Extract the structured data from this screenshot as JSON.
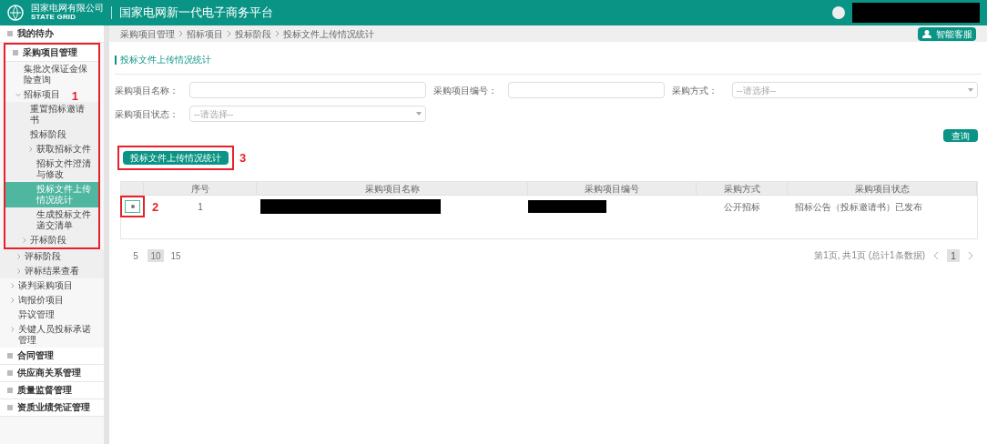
{
  "header": {
    "logo_cn": "国家电网有限公司",
    "logo_en": "STATE GRID",
    "title": "国家电网新一代电子商务平台",
    "user_redacted": true
  },
  "sidebar": {
    "items": [
      {
        "label": "我的待办",
        "kind": "section"
      },
      {
        "label": "采购项目管理",
        "kind": "section",
        "children": [
          {
            "label": "集批次保证金保险查询",
            "selected": false
          },
          {
            "label": "招标项目",
            "selected": false,
            "expanded": true,
            "children": [
              {
                "label": "重置招标邀请书",
                "selected": false
              },
              {
                "label": "投标阶段",
                "selected": false,
                "children": [
                  {
                    "label": "获取招标文件",
                    "selected": false,
                    "expanded": false
                  },
                  {
                    "label": "招标文件澄清与修改",
                    "selected": false
                  },
                  {
                    "label": "投标文件上传情况统计",
                    "selected": true
                  },
                  {
                    "label": "生成投标文件递交清单",
                    "selected": false
                  }
                ]
              },
              {
                "label": "开标阶段",
                "selected": false,
                "expanded": false
              },
              {
                "label": "评标阶段",
                "selected": false,
                "expanded": false
              },
              {
                "label": "评标结果查看",
                "selected": false,
                "expanded": false
              }
            ]
          },
          {
            "label": "谈判采购项目",
            "selected": false,
            "expanded": false
          },
          {
            "label": "询报价项目",
            "selected": false,
            "expanded": false
          },
          {
            "label": "异议管理",
            "selected": false
          },
          {
            "label": "关键人员投标承诺管理",
            "selected": false,
            "expanded": false
          }
        ]
      },
      {
        "label": "合同管理",
        "kind": "section"
      },
      {
        "label": "供应商关系管理",
        "kind": "section"
      },
      {
        "label": "质量监督管理",
        "kind": "section"
      },
      {
        "label": "资质业绩凭证管理",
        "kind": "section"
      }
    ]
  },
  "breadcrumb": [
    "采购项目管理",
    "招标项目",
    "投标阶段",
    "投标文件上传情况统计"
  ],
  "help_button": "智能客服",
  "panel_title": "投标文件上传情况统计",
  "filters": [
    {
      "label": "采购项目名称：",
      "kind": "text"
    },
    {
      "label": "采购项目编号：",
      "kind": "text"
    },
    {
      "label": "采购方式：",
      "kind": "select",
      "placeholder": "--请选择--"
    },
    {
      "label": "采购项目状态：",
      "kind": "select",
      "placeholder": "--请选择--"
    }
  ],
  "query_button": "查询",
  "action_button": "投标文件上传情况统计",
  "table": {
    "columns": [
      "序号",
      "采购项目名称",
      "采购项目编号",
      "采购方式",
      "采购项目状态"
    ],
    "rows": [
      {
        "selected": true,
        "index": "1",
        "name_redacted": true,
        "code_redacted": true,
        "method": "公开招标",
        "status": "招标公告（投标邀请书）已发布"
      }
    ]
  },
  "page_sizes": [
    {
      "label": "5",
      "selected": false
    },
    {
      "label": "10",
      "selected": true
    },
    {
      "label": "15",
      "selected": false
    }
  ],
  "pagination": {
    "summary": "第1页, 共1页 (总计1条数据)",
    "pages": [
      {
        "label": "1",
        "selected": true
      }
    ]
  },
  "annotations": [
    {
      "label": "1"
    },
    {
      "label": "2"
    },
    {
      "label": "3"
    }
  ]
}
